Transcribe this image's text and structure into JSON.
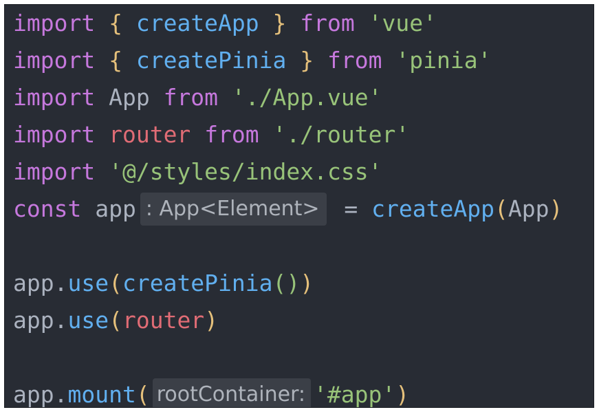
{
  "lines": [
    {
      "tokens": [
        {
          "text": "import",
          "kind": "kw"
        },
        {
          "text": " ",
          "kind": "plain"
        },
        {
          "text": "{",
          "kind": "br"
        },
        {
          "text": " ",
          "kind": "plain"
        },
        {
          "text": "createApp",
          "kind": "fn"
        },
        {
          "text": " ",
          "kind": "plain"
        },
        {
          "text": "}",
          "kind": "br"
        },
        {
          "text": " ",
          "kind": "plain"
        },
        {
          "text": "from",
          "kind": "kw"
        },
        {
          "text": " ",
          "kind": "plain"
        },
        {
          "text": "'vue'",
          "kind": "str"
        }
      ]
    },
    {
      "tokens": [
        {
          "text": "import",
          "kind": "kw"
        },
        {
          "text": " ",
          "kind": "plain"
        },
        {
          "text": "{",
          "kind": "br"
        },
        {
          "text": " ",
          "kind": "plain"
        },
        {
          "text": "createPinia",
          "kind": "fn"
        },
        {
          "text": " ",
          "kind": "plain"
        },
        {
          "text": "}",
          "kind": "br"
        },
        {
          "text": " ",
          "kind": "plain"
        },
        {
          "text": "from",
          "kind": "kw"
        },
        {
          "text": " ",
          "kind": "plain"
        },
        {
          "text": "'pinia'",
          "kind": "str"
        }
      ]
    },
    {
      "tokens": [
        {
          "text": "import",
          "kind": "kw"
        },
        {
          "text": " App ",
          "kind": "plain"
        },
        {
          "text": "from",
          "kind": "kw"
        },
        {
          "text": " ",
          "kind": "plain"
        },
        {
          "text": "'./App.vue'",
          "kind": "str"
        }
      ]
    },
    {
      "tokens": [
        {
          "text": "import",
          "kind": "kw"
        },
        {
          "text": " ",
          "kind": "plain"
        },
        {
          "text": "router",
          "kind": "var"
        },
        {
          "text": " ",
          "kind": "plain"
        },
        {
          "text": "from",
          "kind": "kw"
        },
        {
          "text": " ",
          "kind": "plain"
        },
        {
          "text": "'./router'",
          "kind": "str"
        }
      ]
    },
    {
      "tokens": [
        {
          "text": "import",
          "kind": "kw"
        },
        {
          "text": " ",
          "kind": "plain"
        },
        {
          "text": "'@/styles/index.css'",
          "kind": "str"
        }
      ]
    },
    {
      "tokens": [
        {
          "text": "const",
          "kind": "kw"
        },
        {
          "text": " app",
          "kind": "plain"
        },
        {
          "hint": ": App<Element>"
        },
        {
          "text": " = ",
          "kind": "plain"
        },
        {
          "text": "createApp",
          "kind": "fn"
        },
        {
          "text": "(",
          "kind": "br"
        },
        {
          "text": "App",
          "kind": "plain"
        },
        {
          "text": ")",
          "kind": "br"
        }
      ]
    },
    {
      "tokens": []
    },
    {
      "tokens": [
        {
          "text": "app.",
          "kind": "plain"
        },
        {
          "text": "use",
          "kind": "fn"
        },
        {
          "text": "(",
          "kind": "br"
        },
        {
          "text": "createPinia",
          "kind": "fn"
        },
        {
          "text": "()",
          "kind": "br2"
        },
        {
          "text": ")",
          "kind": "br"
        }
      ]
    },
    {
      "tokens": [
        {
          "text": "app.",
          "kind": "plain"
        },
        {
          "text": "use",
          "kind": "fn"
        },
        {
          "text": "(",
          "kind": "br"
        },
        {
          "text": "router",
          "kind": "var"
        },
        {
          "text": ")",
          "kind": "br"
        }
      ]
    },
    {
      "tokens": []
    },
    {
      "tokens": [
        {
          "text": "app.",
          "kind": "plain"
        },
        {
          "text": "mount",
          "kind": "fn"
        },
        {
          "text": "(",
          "kind": "br"
        },
        {
          "hint": "rootContainer:",
          "alt": true
        },
        {
          "text": "'#app'",
          "kind": "str"
        },
        {
          "text": ")",
          "kind": "br"
        }
      ]
    }
  ],
  "colors": {
    "background": "#282c34",
    "keyword": "#c678dd",
    "function": "#61afef",
    "string": "#98c379",
    "bracket": "#e5c07b",
    "variable": "#e06c75",
    "plain": "#abb2bf",
    "inlay_hint_bg": "#3b3f47"
  }
}
